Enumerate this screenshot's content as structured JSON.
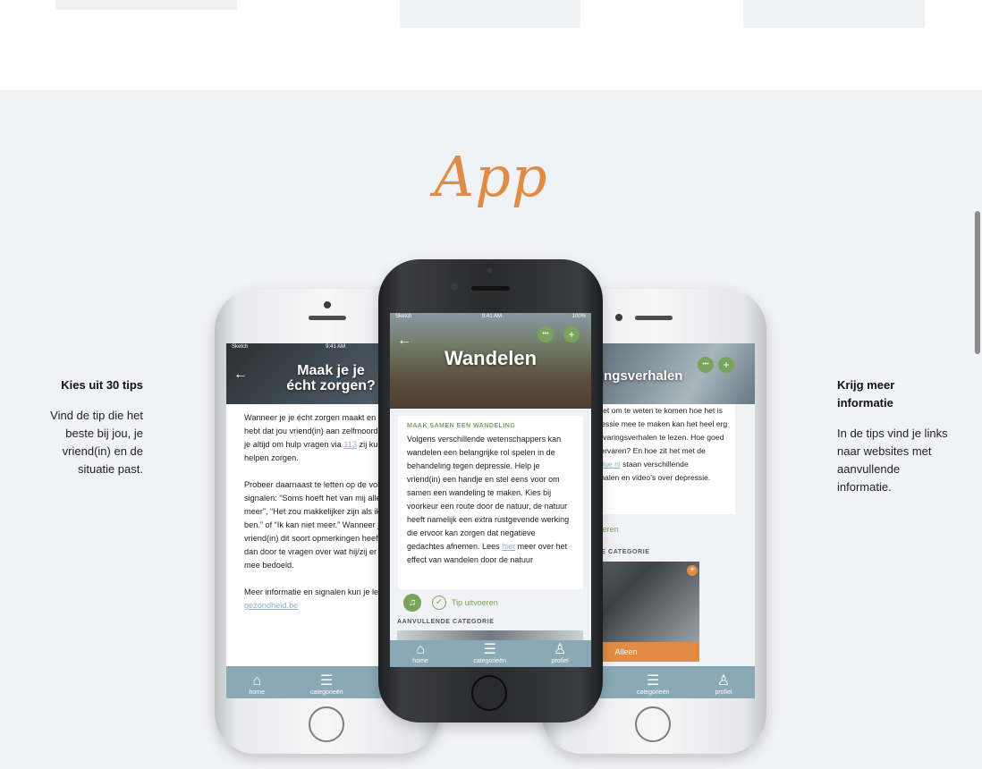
{
  "section_title": "App",
  "left_feature": {
    "title": "Kies uit 30 tips",
    "text": "Vind de tip die het beste bij jou, je vriend(in) en de situatie past."
  },
  "right_feature": {
    "title": "Krijg meer informatie",
    "text": "In de tips vind je links naar websites met aanvullende informatie."
  },
  "phone_left": {
    "status_left": "Sketch",
    "status_time": "9:41 AM",
    "title": "Maak je je écht zorgen?",
    "p1_before": "Wanneer je je écht zorgen maakt en gevoel hebt dat jou vriend(in) aan zelfmoord denkt kan je altijd om hulp vragen via ",
    "p1_link": "113",
    "p1_after": " zij kunnen jou helpen zorgen.",
    "p2": "Probeer daarnaast te letten op de volgende signalen: “Soms hoeft het van mij allemaal niet meer”, “Het zou makkelijker zijn als ik niet meer ben.” of “Ik kan niet meer.” Wanneer jou vriend(in) dit soort opmerkingen heeft probeer dan door te vragen over wat hij/zij er precies mee bedoeld.",
    "p3_before": "Meer informatie en signalen kun je lezen op ",
    "p3_link": "gezondheid.be",
    "tabs": [
      "home",
      "categorieën",
      "profiel"
    ]
  },
  "phone_center": {
    "status_left": "Sketch",
    "status_time": "9:41 AM",
    "status_right": "100%",
    "title": "Wandelen",
    "more_icon": "•••",
    "plus_icon": "+",
    "card_heading": "MAAK SAMEN EEN WANDELING",
    "body_before": "Volgens verschillende wetenschappers kan wandelen een belangrijke rol spelen in de behandeling tegen depressie. Help je vriend(in) een handje en stel eens voor om samen een wandeling te maken. Kies bij voorkeur een route door de natuur, de natuur heeft namelijk een extra rustgevende werking die ervoor kan zorgen dat negatieve gedachtes afnemen. Lees ",
    "body_link": "hier",
    "body_after": " meer over het effect van wandelen door de natuur",
    "tip_label": "Tip uitvoeren",
    "extra_heading": "AANVULLENDE CATEGORIE",
    "tabs": [
      "home",
      "categorieën",
      "profiel"
    ]
  },
  "phone_right": {
    "title": "Ervaringsverhalen",
    "body_before": "Soms helpt het om te weten te komen hoe het is om een depressie mee te maken kan het heel erg helpen om ervaringsverhalen te lezen. Hoe goed mensen het ervaren? En hoe zit het met de omgeving? ",
    "body_link": "blue.nl",
    "body_after": " staan verschillende ervaringsverhalen en video's over depressie.",
    "tip_label": "Tip uitvoeren",
    "extra_heading": "AANVULLENDE CATEGORIE",
    "category_label": "Alleen",
    "tabs": [
      "home",
      "categorieën",
      "profiel"
    ]
  },
  "colors": {
    "accent": "#e08c45",
    "green": "#7aa35e",
    "tabbar": "#8aa8b6",
    "section_bg": "#f1f2f6"
  }
}
